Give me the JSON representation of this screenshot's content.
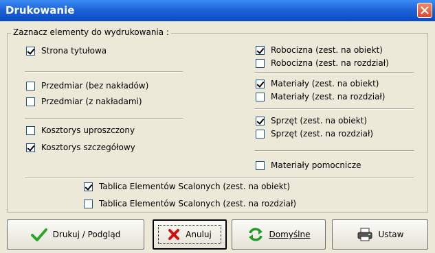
{
  "window": {
    "title": "Drukowanie",
    "close_icon": "close-icon"
  },
  "group": {
    "label": "Zaznacz elementy do wydrukowania :"
  },
  "left": [
    {
      "label": "Strona tytułowa",
      "checked": true
    },
    {
      "label": "Przedmiar (bez nakładów)",
      "checked": false
    },
    {
      "label": "Przedmiar (z nakładami)",
      "checked": false
    },
    {
      "label": "Kosztorys uproszczony",
      "checked": false
    },
    {
      "label": "Kosztorys szczegółowy",
      "checked": true
    }
  ],
  "right": [
    {
      "label": "Robocizna (zest. na obiekt)",
      "checked": true
    },
    {
      "label": "Robocizna (zest. na rozdział)",
      "checked": false
    },
    {
      "label": "Materiały (zest. na obiekt)",
      "checked": true
    },
    {
      "label": "Materiały (zest. na rozdział)",
      "checked": false
    },
    {
      "label": "Sprzęt (zest. na obiekt)",
      "checked": true
    },
    {
      "label": "Sprzęt (zest. na rozdział)",
      "checked": false
    },
    {
      "label": "Materiały pomocnicze",
      "checked": false
    }
  ],
  "bottom": [
    {
      "label": "Tablica Elementów Scalonych (zest. na obiekt)",
      "checked": true
    },
    {
      "label": "Tablica Elementów Scalonych (zest. na rozdział)",
      "checked": false
    }
  ],
  "buttons": {
    "print": "Drukuj / Podgląd",
    "cancel": "Anuluj",
    "defaults": "Domyślne",
    "setup": "Ustaw"
  },
  "colors": {
    "titlebar": "#0a4cc4",
    "check_green": "#2aa52a",
    "cancel_red": "#d01010",
    "refresh_green": "#1f9a2b"
  }
}
